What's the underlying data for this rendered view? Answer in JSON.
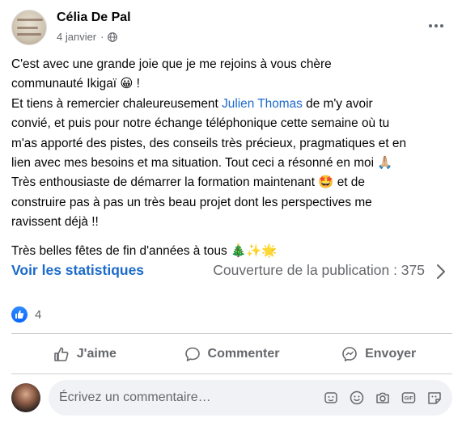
{
  "post": {
    "author": "Célia De Pal",
    "date": "4 janvier",
    "privacy_icon": "globe-icon",
    "paragraph1": [
      "C'est avec une grande joie que je me rejoins à vous chère",
      "communauté Ikigaï 😀 !",
      "Et tiens à remercier chaleureusement ",
      "Julien Thomas",
      " de m'y avoir",
      "convié, et puis pour notre échange téléphonique cette semaine où tu",
      "m'as apporté des pistes, des conseils très précieux, pragmatiques et en",
      "lien avec mes besoins et ma situation. Tout ceci a résonné en moi 🙏🏼",
      "Très enthousiaste de démarrer la formation maintenant 🤩 et de",
      "construire pas à pas un très beau projet dont les perspectives me",
      "ravissent déjà !!"
    ],
    "paragraph2": "Très belles fêtes de fin d'années à tous 🎄✨🌟"
  },
  "stats": {
    "link_label": "Voir les statistiques",
    "coverage": "Couverture de la publication : 375"
  },
  "reactions": {
    "count": "4",
    "icon": "like-icon"
  },
  "actions": {
    "like": "J'aime",
    "comment": "Commenter",
    "send": "Envoyer"
  },
  "comment": {
    "placeholder": "Écrivez un commentaire…",
    "tools": [
      "sticker-icon",
      "emoji-icon",
      "camera-icon",
      "gif-icon",
      "sticker-face-icon"
    ]
  },
  "colors": {
    "accent": "#1b6ac9",
    "like_blue": "#0866ff",
    "muted_text": "#65676b",
    "comment_bg": "#f0f2f5"
  }
}
